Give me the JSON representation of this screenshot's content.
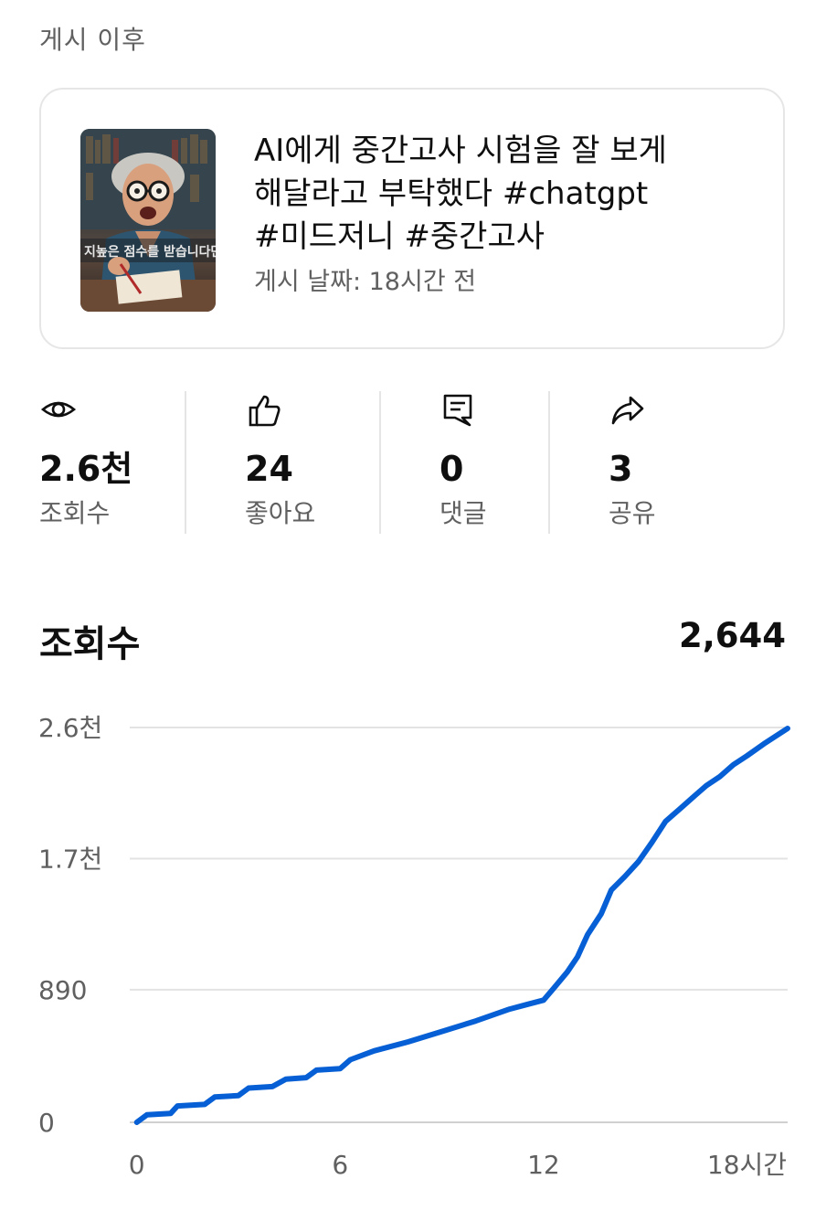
{
  "section_label": "게시 이후",
  "video": {
    "title_lines": [
      "AI에게 중간고사 시험을 잘 보게",
      "해달라고 부탁했다 #chatgpt",
      "#미드저니 #중간고사"
    ],
    "posted": "게시 날짜: 18시간 전",
    "thumbnail_caption": "지금 이 점수 마든 / 높은 점수를 받습니다만"
  },
  "stats": [
    {
      "icon": "eye-icon",
      "value": "2.6천",
      "label": "조회수"
    },
    {
      "icon": "thumbs-up-icon",
      "value": "24",
      "label": "좋아요"
    },
    {
      "icon": "comment-icon",
      "value": "0",
      "label": "댓글"
    },
    {
      "icon": "share-icon",
      "value": "3",
      "label": "공유"
    }
  ],
  "chart": {
    "title": "조회수",
    "total": "2,644"
  },
  "chart_data": {
    "type": "line",
    "title": "조회수",
    "xlabel": "",
    "ylabel": "",
    "x_ticks": [
      "0",
      "6",
      "12",
      "18시간"
    ],
    "x_tick_values": [
      0,
      6,
      12,
      18
    ],
    "y_ticks": [
      "0",
      "890",
      "1.7천",
      "2.6천"
    ],
    "y_tick_values": [
      0,
      890,
      1770,
      2650
    ],
    "xlim": [
      -0.1,
      19.2
    ],
    "ylim": [
      0,
      2650
    ],
    "grid": true,
    "color": "#065fd4",
    "series": [
      {
        "x": [
          0.0,
          0.3,
          1.0,
          1.2,
          2.0,
          2.3,
          3.0,
          3.3,
          4.0,
          4.4,
          5.0,
          5.3,
          6.0,
          6.3,
          7.0,
          8.0,
          9.0,
          10.0,
          11.0,
          11.5,
          12.0,
          12.3,
          12.7,
          13.0,
          13.3,
          13.7,
          14.0,
          14.4,
          14.8,
          15.2,
          15.6,
          16.0,
          16.4,
          16.8,
          17.2,
          17.6,
          18.0,
          18.5,
          19.2
        ],
        "y": [
          0,
          50,
          60,
          110,
          120,
          170,
          180,
          230,
          240,
          290,
          300,
          350,
          360,
          420,
          480,
          540,
          610,
          680,
          760,
          790,
          820,
          900,
          1010,
          1110,
          1260,
          1400,
          1560,
          1650,
          1750,
          1880,
          2020,
          2100,
          2180,
          2260,
          2320,
          2400,
          2460,
          2540,
          2644
        ]
      }
    ]
  }
}
